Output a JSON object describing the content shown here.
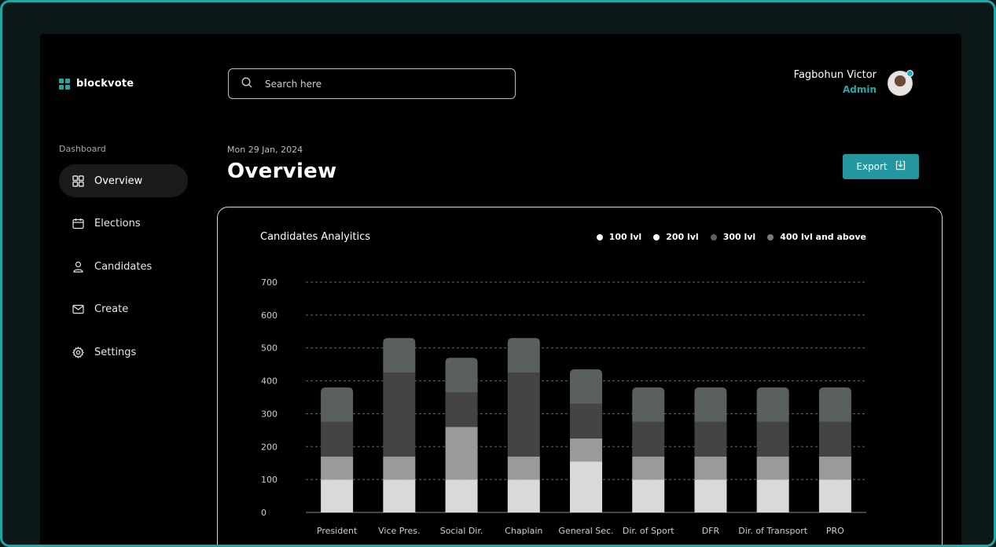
{
  "brand": {
    "name": "blockvote",
    "accent": "#2aa3a3"
  },
  "sidebar": {
    "section_label": "Dashboard",
    "items": [
      {
        "label": "Overview",
        "icon": "grid-icon",
        "active": true
      },
      {
        "label": "Elections",
        "icon": "calendar-icon",
        "active": false
      },
      {
        "label": "Candidates",
        "icon": "user-icon",
        "active": false
      },
      {
        "label": "Create",
        "icon": "mail-icon",
        "active": false
      },
      {
        "label": "Settings",
        "icon": "gear-icon",
        "active": false
      }
    ]
  },
  "search": {
    "placeholder": "Search here",
    "value": ""
  },
  "user": {
    "name": "Fagbohun Victor",
    "role": "Admin"
  },
  "header": {
    "date": "Mon 29 Jan, 2024",
    "title": "Overview",
    "export_label": "Export"
  },
  "chart_data": {
    "type": "bar",
    "stacked": true,
    "title": "Candidates Analyitics",
    "categories": [
      "President",
      "Vice Pres.",
      "Social Dir.",
      "Chaplain",
      "General Sec.",
      "Dir. of Sport",
      "DFR",
      "Dir. of Transport",
      "PRO"
    ],
    "ylim": [
      0,
      700
    ],
    "yticks": [
      0,
      100,
      200,
      300,
      400,
      500,
      600,
      700
    ],
    "grid": true,
    "legend_position": "top-right",
    "series": [
      {
        "name": "100 lvl",
        "color": "#d9d9d9",
        "values": [
          100,
          100,
          100,
          100,
          155,
          100,
          100,
          100,
          100
        ]
      },
      {
        "name": "200 lvl",
        "color": "#9a9a9a",
        "values": [
          70,
          70,
          160,
          70,
          70,
          70,
          70,
          70,
          70
        ]
      },
      {
        "name": "300 lvl",
        "color": "#444444",
        "values": [
          105,
          255,
          105,
          255,
          105,
          105,
          105,
          105,
          105
        ]
      },
      {
        "name": "400 lvl and above",
        "color": "#5a6060",
        "values": [
          105,
          105,
          105,
          105,
          105,
          105,
          105,
          105,
          105
        ]
      }
    ],
    "legend_dot_colors": [
      "#ffffff",
      "#ffffff",
      "#7a7a7a",
      "#7a7a7a"
    ]
  }
}
